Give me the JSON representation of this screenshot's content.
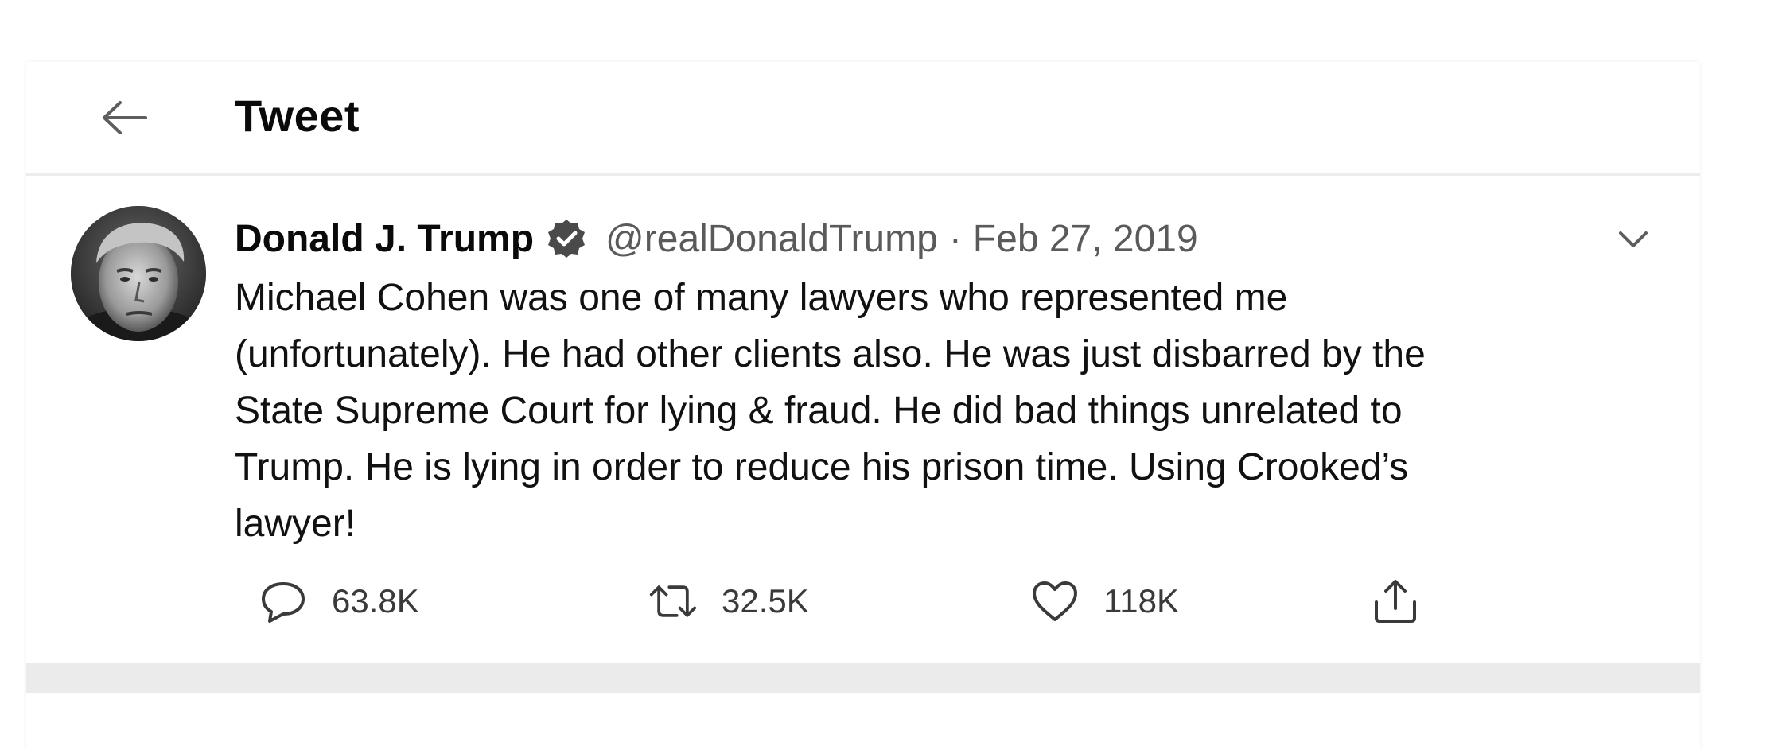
{
  "header": {
    "title": "Tweet",
    "back_icon": "arrow-left-icon"
  },
  "tweet": {
    "author_name": "Donald J. Trump",
    "verified": true,
    "handle": "@realDonaldTrump",
    "separator": "·",
    "date": "Feb 27, 2019",
    "text": "Michael Cohen was one of many lawyers who represented me\n(unfortunately). He had other clients also. He was just disbarred by the\nState Supreme Court for lying & fraud. He did bad things unrelated to\nTrump. He is lying in order to reduce his prison time. Using Crooked’s\nlawyer!",
    "more_icon": "chevron-down-icon"
  },
  "actions": {
    "reply": {
      "icon": "reply-icon",
      "count": "63.8K"
    },
    "retweet": {
      "icon": "retweet-icon",
      "count": "32.5K"
    },
    "like": {
      "icon": "heart-icon",
      "count": "118K"
    },
    "share": {
      "icon": "share-icon"
    }
  },
  "colors": {
    "text": "#111111",
    "secondary": "#5a5a5a",
    "divider": "#ebebeb"
  }
}
